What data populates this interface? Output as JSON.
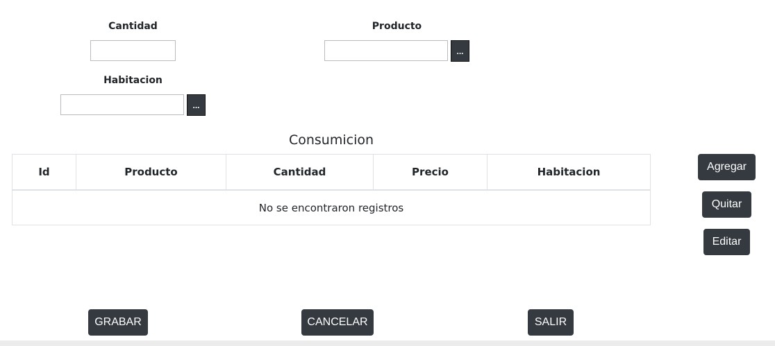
{
  "form": {
    "cantidad": {
      "label": "Cantidad",
      "value": ""
    },
    "producto": {
      "label": "Producto",
      "value": "",
      "picker_label": "..."
    },
    "habitacion": {
      "label": "Habitacion",
      "value": "",
      "picker_label": "..."
    }
  },
  "table": {
    "title": "Consumicion",
    "columns": [
      "Id",
      "Producto",
      "Cantidad",
      "Precio",
      "Habitacion"
    ],
    "rows": [],
    "empty_message": "No se encontraron registros"
  },
  "side_actions": {
    "add": "Agregar",
    "remove": "Quitar",
    "edit": "Editar"
  },
  "footer_actions": {
    "save": "GRABAR",
    "cancel": "CANCELAR",
    "exit": "SALIR"
  }
}
